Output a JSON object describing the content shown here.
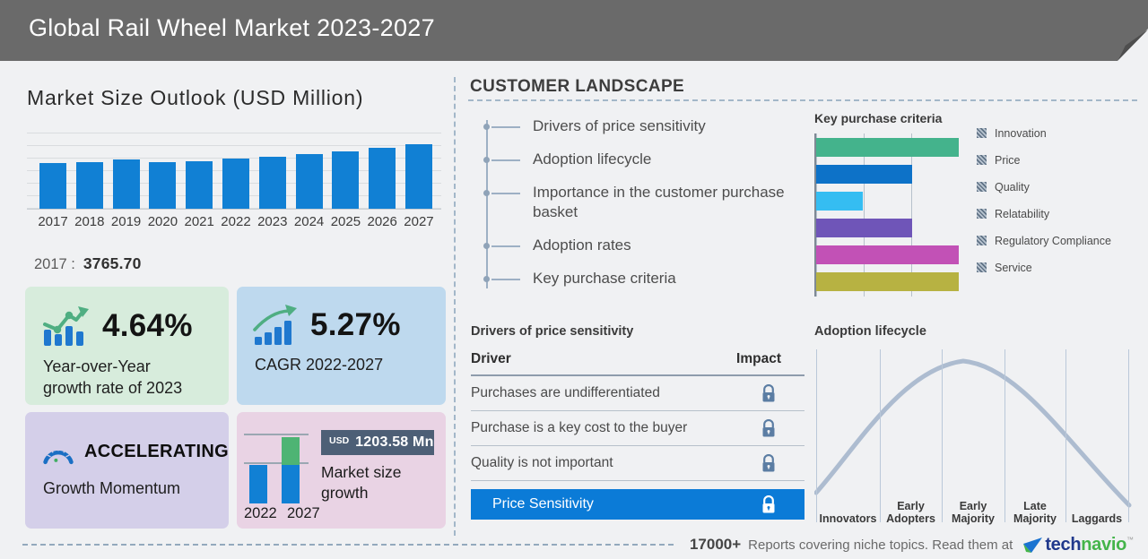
{
  "header": {
    "title": "Global Rail Wheel Market 2023-2027"
  },
  "market_outlook": {
    "title": "Market Size Outlook (USD Million)",
    "base_year_label": "2017 :",
    "base_year_value": "3765.70"
  },
  "cards": {
    "yoy": {
      "value": "4.64%",
      "label_line1": "Year-over-Year",
      "label_line2": "growth rate of 2023",
      "icon": "bar-chart-trendline-icon"
    },
    "cagr": {
      "value": "5.27%",
      "label": "CAGR 2022-2027",
      "icon": "rising-bars-arrow-icon"
    },
    "momentum": {
      "value": "ACCELERATING",
      "label": "Growth Momentum",
      "icon": "speedometer-icon"
    },
    "growth": {
      "currency": "USD",
      "amount": "1203.58 Mn",
      "label_line1": "Market size",
      "label_line2": "growth",
      "years": [
        "2022",
        "2027"
      ]
    }
  },
  "customer_landscape": {
    "title": "CUSTOMER LANDSCAPE",
    "items": [
      "Drivers of price sensitivity",
      "Adoption lifecycle",
      "Importance in the customer purchase basket",
      "Adoption rates",
      "Key purchase criteria"
    ]
  },
  "key_purchase_criteria": {
    "title": "Key purchase criteria"
  },
  "price_sensitivity": {
    "title": "Drivers of price sensitivity",
    "col_driver": "Driver",
    "col_impact": "Impact",
    "rows": [
      "Purchases are undifferentiated",
      "Purchase is a key cost to the buyer",
      "Quality is not important"
    ],
    "selected": "Price Sensitivity"
  },
  "adoption_lifecycle": {
    "title": "Adoption lifecycle",
    "stages": [
      [
        "Innovators"
      ],
      [
        "Early",
        "Adopters"
      ],
      [
        "Early",
        "Majority"
      ],
      [
        "Late",
        "Majority"
      ],
      [
        "Laggards"
      ]
    ]
  },
  "footer": {
    "count": "17000+",
    "text": "Reports covering niche topics. Read them at",
    "brand_tech": "tech",
    "brand_navio": "navio",
    "trademark": "™"
  },
  "chart_data": [
    {
      "type": "bar",
      "title": "Market Size Outlook (USD Million)",
      "categories": [
        "2017",
        "2018",
        "2019",
        "2020",
        "2021",
        "2022",
        "2023",
        "2024",
        "2025",
        "2026",
        "2027"
      ],
      "values": [
        3765.7,
        3845,
        4045,
        3805,
        3920,
        4113.5,
        4304.4,
        4510,
        4760,
        5000,
        5317.1
      ],
      "labeled_value": {
        "year": "2017",
        "value": 3765.7
      },
      "ylim": [
        0,
        6200
      ],
      "grid": true,
      "bar_color": "#1180d4"
    },
    {
      "type": "bar",
      "orientation": "horizontal",
      "title": "Key purchase criteria",
      "categories": [
        "Innovation",
        "Price",
        "Quality",
        "Relatability",
        "Regulatory Compliance",
        "Service"
      ],
      "values": [
        100,
        67,
        33,
        67,
        100,
        100
      ],
      "xlim": [
        0,
        100
      ],
      "colors": [
        "#44b38c",
        "#0d72c8",
        "#35bdf2",
        "#6f55b8",
        "#c251b6",
        "#b7b242"
      ],
      "legend_position": "right",
      "grid": true
    },
    {
      "type": "bar",
      "title": "Market size growth",
      "categories": [
        "2022",
        "2027"
      ],
      "values": [
        4113.5,
        5317.1
      ],
      "growth_label": "USD 1203.58 Mn",
      "colors": [
        "#1180d4",
        "#1180d4 with #4eb474 growth segment"
      ]
    },
    {
      "type": "line",
      "title": "Adoption lifecycle",
      "categories": [
        "Innovators",
        "Early Adopters",
        "Early Majority",
        "Late Majority",
        "Laggards"
      ],
      "shape": "bell curve peaking over Early Majority",
      "line_color": "#adbcd0"
    }
  ]
}
